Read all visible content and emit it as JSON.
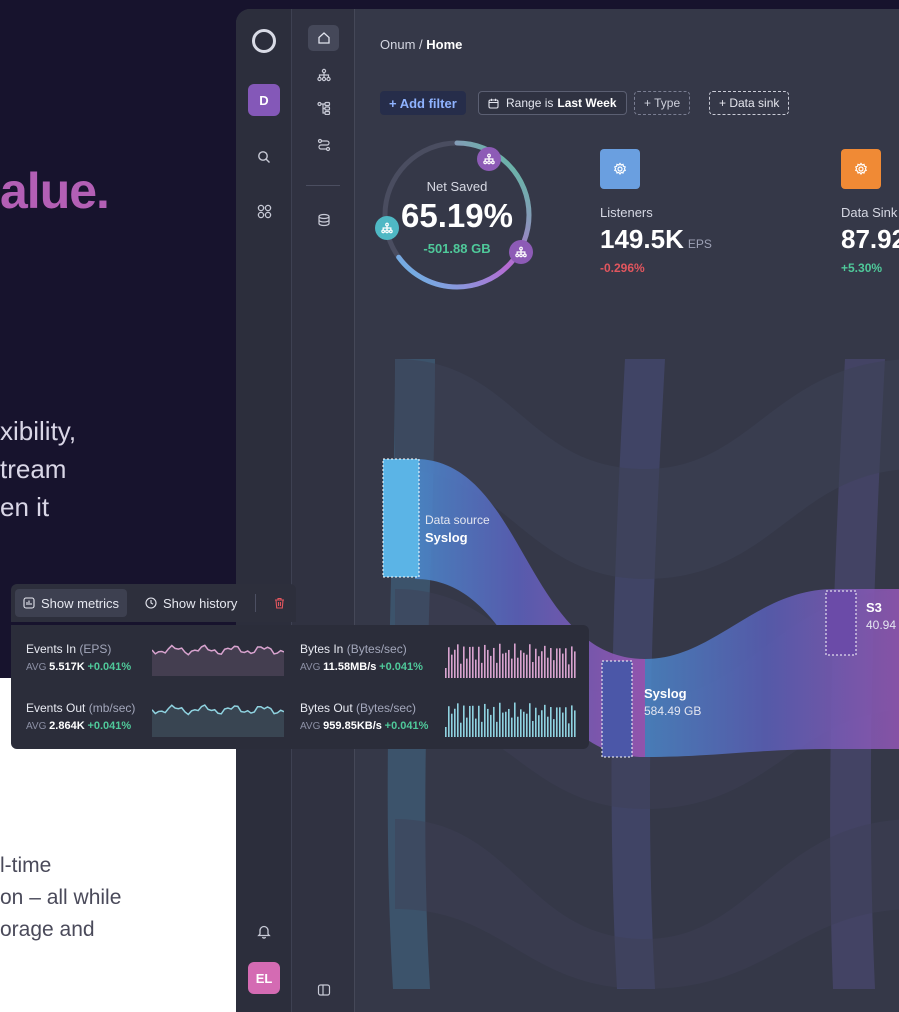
{
  "marketing": {
    "headline_fragment": "alue.",
    "para_lines": [
      "xibility,",
      "tream",
      "en it"
    ],
    "para2_lines": [
      "l-time",
      "on – all while",
      "orage and"
    ]
  },
  "rail": {
    "workspace_avatar": "D",
    "user_avatar": "EL"
  },
  "breadcrumb": {
    "root": "Onum",
    "separator": "/",
    "current": "Home"
  },
  "filters": {
    "add_label": "+ Add filter",
    "range_prefix": "Range is",
    "range_value": "Last Week",
    "type_label": "+ Type",
    "sink_label": "+ Data sink"
  },
  "gauge": {
    "label": "Net Saved",
    "value": "65.19%",
    "sub": "-501.88 GB",
    "fill_fraction": 0.65
  },
  "stats": [
    {
      "name": "Listeners",
      "value": "149.5K",
      "unit": "EPS",
      "delta": "-0.296%",
      "color": "#6a9fe0",
      "delta_color": "#e2565e"
    },
    {
      "name": "Data Sink",
      "value": "87.92",
      "unit": "",
      "delta": "+5.30%",
      "color": "#f08a35",
      "delta_color": "#4fc99a"
    }
  ],
  "flow": {
    "source": {
      "kicker": "Data source",
      "name": "Syslog"
    },
    "middle": {
      "name": "Syslog",
      "size": "584.49 GB"
    },
    "right": {
      "name": "S3",
      "size": "40.94"
    }
  },
  "toolbar": {
    "metrics_label": "Show metrics",
    "history_label": "Show history"
  },
  "metrics": [
    {
      "title": "Events In",
      "unit": "(EPS)",
      "avg_label": "AVG",
      "avg": "5.517K",
      "delta": "+0.041%",
      "color": "#d9a3cf"
    },
    {
      "title": "Bytes In",
      "unit": "(Bytes/sec)",
      "avg_label": "AVG",
      "avg": "11.58MB/s",
      "delta": "+0.041%",
      "color": "#d9a3cf"
    },
    {
      "title": "Events Out",
      "unit": "(mb/sec)",
      "avg_label": "AVG",
      "avg": "2.864K",
      "delta": "+0.041%",
      "color": "#8fd3e0"
    },
    {
      "title": "Bytes Out",
      "unit": "(Bytes/sec)",
      "avg_label": "AVG",
      "avg": "959.85KB/s",
      "delta": "+0.041%",
      "color": "#8fd3e0"
    }
  ]
}
